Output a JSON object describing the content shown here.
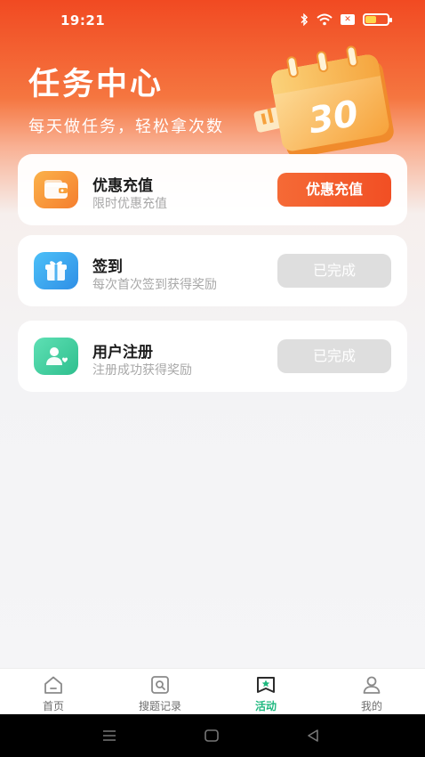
{
  "status_bar": {
    "time": "19:21",
    "icons": [
      "bluetooth-icon",
      "wifi-icon",
      "x-badge-icon",
      "battery-icon"
    ],
    "battery_color": "#ffd54a"
  },
  "header": {
    "title": "任务中心",
    "subtitle": "每天做任务，轻松拿次数",
    "illustration_number": "30",
    "illustration_icon": "calendar-icon"
  },
  "tasks": [
    {
      "title": "优惠充值",
      "desc": "限时优惠充值",
      "button": "优惠充值",
      "status": "active",
      "icon": "wallet-icon",
      "icon_color": "#f68a35"
    },
    {
      "title": "签到",
      "desc": "每次首次签到获得奖励",
      "button": "已完成",
      "status": "done",
      "icon": "gift-icon",
      "icon_color": "#35a9ee"
    },
    {
      "title": "用户注册",
      "desc": "注册成功获得奖励",
      "button": "已完成",
      "status": "done",
      "icon": "user-heart-icon",
      "icon_color": "#3fd0a0"
    }
  ],
  "tab_bar": {
    "items": [
      {
        "label": "首页",
        "icon": "home-icon",
        "active": false
      },
      {
        "label": "搜题记录",
        "icon": "search-record-icon",
        "active": false
      },
      {
        "label": "活动",
        "icon": "activity-icon",
        "active": true
      },
      {
        "label": "我的",
        "icon": "profile-icon",
        "active": false
      }
    ],
    "active_color": "#1fb87f"
  },
  "nav_bar": {
    "icons": [
      "menu-icon",
      "home-square-icon",
      "back-icon"
    ]
  },
  "colors": {
    "accent": "#f14f24",
    "done_button": "#dedede"
  }
}
